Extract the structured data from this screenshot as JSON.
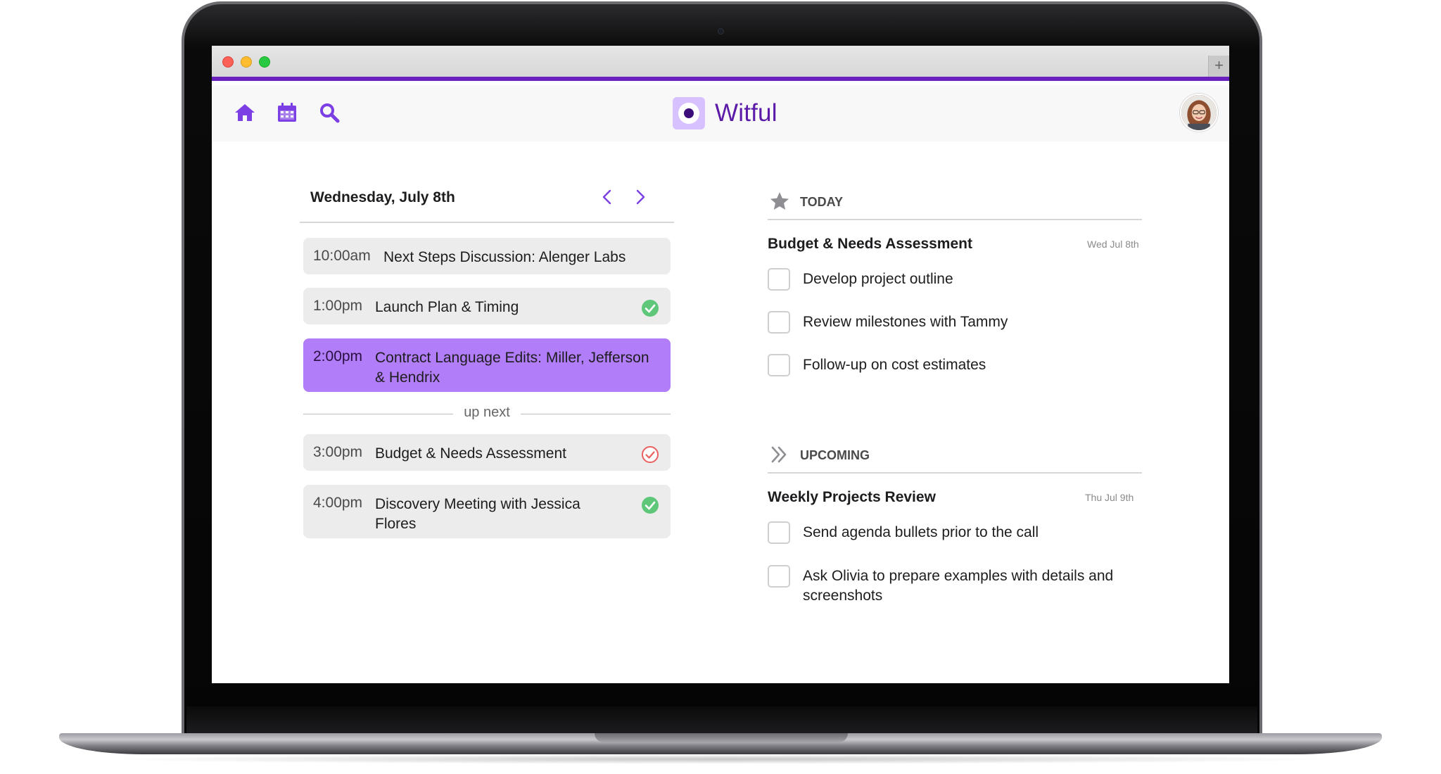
{
  "app": {
    "name": "Witful"
  },
  "nav": {
    "icons": [
      "home-icon",
      "calendar-icon",
      "search-icon"
    ],
    "accent": "#6a1fbf",
    "icon_color": "#7b3fe4"
  },
  "schedule": {
    "date_label": "Wednesday, July 8th",
    "up_next_label": "up next",
    "events": [
      {
        "time": "10:00am",
        "title": "Next Steps Discussion: Alenger Labs",
        "status": "none"
      },
      {
        "time": "1:00pm",
        "title": "Launch Plan & Timing",
        "status": "done"
      },
      {
        "time": "2:00pm",
        "title": "Contract Language Edits: Miller, Jefferson & Hendrix",
        "status": "active"
      },
      {
        "time": "3:00pm",
        "title": "Budget & Needs Assessment",
        "status": "pending"
      },
      {
        "time": "4:00pm",
        "title": "Discovery Meeting with Jessica Flores",
        "status": "done"
      }
    ]
  },
  "tasks": {
    "today": {
      "label": "TODAY",
      "icon": "star-icon",
      "group_title": "Budget & Needs Assessment",
      "group_date": "Wed Jul 8th",
      "items": [
        "Develop project outline",
        "Review milestones with Tammy",
        "Follow-up on cost estimates"
      ]
    },
    "upcoming": {
      "label": "UPCOMING",
      "icon": "double-chevron-right-icon",
      "group_title": "Weekly Projects Review",
      "group_date": "Thu Jul 9th",
      "items": [
        "Send agenda bullets prior to the call",
        "Ask Olivia to prepare examples with details and screenshots"
      ]
    }
  },
  "colors": {
    "active_event": "#b17df8",
    "event_bg": "#ececec",
    "done_check": "#5fc77a",
    "pending_check": "#e8605f"
  }
}
